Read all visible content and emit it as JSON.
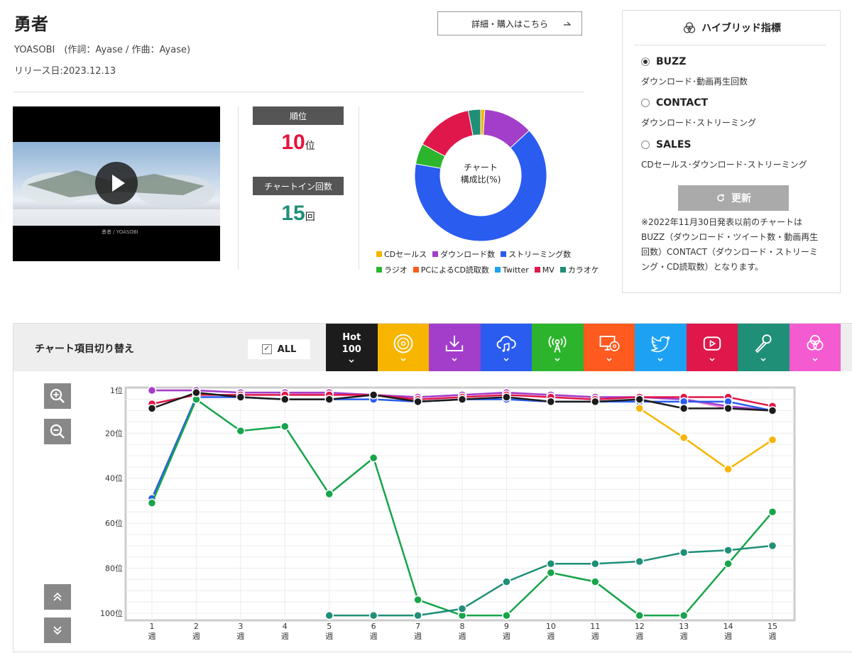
{
  "song": {
    "title": "勇者",
    "artist_line": "YOASOBI　(作詞：Ayase / 作曲：Ayase)",
    "release": "リリース日:2023.12.13",
    "detail_button": "詳細・購入はこちら",
    "detail_arrow": "→"
  },
  "stats": {
    "rank_label": "順位",
    "rank_value": "10",
    "rank_unit": "位",
    "count_label": "チャートイン回数",
    "count_value": "15",
    "count_unit": "回"
  },
  "video": {
    "caption": "勇者 / YOASOBI"
  },
  "composition": {
    "center_line1": "チャート",
    "center_line2": "構成比(%)",
    "slices": [
      {
        "name": "CDセールス",
        "value": 1,
        "color": "#f7b500"
      },
      {
        "name": "ダウンロード数",
        "value": 12,
        "color": "#a23ec9"
      },
      {
        "name": "ストリーミング数",
        "value": 64,
        "color": "#2a5cf0"
      },
      {
        "name": "ラジオ",
        "value": 5,
        "color": "#2cb52c"
      },
      {
        "name": "PCによるCD読取数",
        "value": 0,
        "color": "#ff5a1f"
      },
      {
        "name": "Twitter",
        "value": 0,
        "color": "#1da1f2"
      },
      {
        "name": "MV",
        "value": 14,
        "color": "#e0174a"
      },
      {
        "name": "カラオケ",
        "value": 3,
        "color": "#1f8f77"
      }
    ]
  },
  "hybrid": {
    "title": "ハイブリッド指標",
    "options": [
      {
        "label": "BUZZ",
        "desc": "ダウンロード･動画再生回数",
        "selected": true
      },
      {
        "label": "CONTACT",
        "desc": "ダウンロード･ストリーミング",
        "selected": false
      },
      {
        "label": "SALES",
        "desc": "CDセールス･ダウンロード･ストリーミング",
        "selected": false
      }
    ],
    "refresh_label": "更新",
    "note": "※2022年11月30日発表以前のチャートはBUZZ（ダウンロード・ツイート数・動画再生回数）CONTACT（ダウンロード・ストリーミング・CD読取数）となります。"
  },
  "switcher": {
    "title": "チャート項目切り替え",
    "all_label": "ALL",
    "hot_line1": "Hot",
    "hot_line2": "100",
    "tabs": [
      {
        "id": "hot100",
        "color": "#1c1c1c",
        "icon": "hot100"
      },
      {
        "id": "cd",
        "color": "#f7b500",
        "icon": "cd-icon"
      },
      {
        "id": "download",
        "color": "#a23ec9",
        "icon": "download-icon"
      },
      {
        "id": "streaming",
        "color": "#2a5cf0",
        "icon": "cloud-music-icon"
      },
      {
        "id": "radio",
        "color": "#2cb52c",
        "icon": "radio-icon"
      },
      {
        "id": "pc",
        "color": "#ff5a1f",
        "icon": "pc-cd-icon"
      },
      {
        "id": "twitter",
        "color": "#1da1f2",
        "icon": "twitter-icon"
      },
      {
        "id": "mv",
        "color": "#e0174a",
        "icon": "youtube-icon"
      },
      {
        "id": "karaoke",
        "color": "#1f8f77",
        "icon": "microphone-icon"
      },
      {
        "id": "hybrid",
        "color": "#f55bd0",
        "icon": "hybrid-icon"
      }
    ]
  },
  "chart_data": {
    "type": "line",
    "x": [
      1,
      2,
      3,
      4,
      5,
      6,
      7,
      8,
      9,
      10,
      11,
      12,
      13,
      14,
      15
    ],
    "x_tick_labels": [
      "1\n週",
      "2\n週",
      "3\n週",
      "4\n週",
      "5\n週",
      "6\n週",
      "7\n週",
      "8\n週",
      "9\n週",
      "10\n週",
      "11\n週",
      "12\n週",
      "13\n週",
      "14\n週",
      "15\n週"
    ],
    "y_ticks": [
      1,
      20,
      40,
      60,
      80,
      100
    ],
    "y_tick_labels": [
      "1位",
      "20位",
      "40位",
      "60位",
      "80位",
      "100位"
    ],
    "ylim": [
      1,
      100
    ],
    "y_inverted": true,
    "grid": true,
    "series": [
      {
        "id": "hybrid",
        "color": "#f08ad8",
        "values": [
          1,
          1,
          2,
          2,
          3,
          3,
          4,
          3,
          2,
          3,
          4,
          4,
          5,
          9,
          10
        ]
      },
      {
        "id": "download",
        "color": "#a23ec9",
        "values": [
          1,
          1,
          2,
          2,
          2,
          3,
          4,
          3,
          2,
          3,
          4,
          4,
          5,
          8,
          10
        ]
      },
      {
        "id": "mv",
        "color": "#e0174a",
        "values": [
          7,
          3,
          3,
          3,
          3,
          3,
          5,
          4,
          3,
          4,
          5,
          4,
          4,
          4,
          8
        ]
      },
      {
        "id": "streaming",
        "color": "#2a5cf0",
        "values": [
          49,
          4,
          4,
          5,
          5,
          5,
          6,
          5,
          5,
          6,
          6,
          6,
          6,
          6,
          10
        ]
      },
      {
        "id": "cd",
        "color": "#f7b500",
        "values": [
          null,
          null,
          null,
          null,
          null,
          null,
          null,
          null,
          null,
          null,
          null,
          9,
          22,
          36,
          23
        ]
      },
      {
        "id": "radio",
        "color": "#17a44a",
        "values": [
          51,
          5,
          19,
          17,
          47,
          31,
          94,
          101,
          101,
          82,
          86,
          101,
          101,
          78,
          55
        ]
      },
      {
        "id": "karaoke",
        "color": "#1f8f77",
        "values": [
          null,
          null,
          null,
          null,
          101,
          101,
          101,
          98,
          86,
          78,
          78,
          77,
          73,
          72,
          70
        ]
      },
      {
        "id": "hot100",
        "color": "#1c1c1c",
        "values": [
          9,
          2,
          4,
          5,
          5,
          3,
          6,
          5,
          4,
          6,
          6,
          5,
          9,
          9,
          10
        ]
      }
    ]
  }
}
